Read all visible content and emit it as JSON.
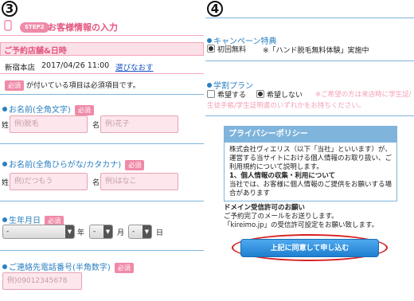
{
  "left": {
    "step_number": "3",
    "step_badge": "STEP2",
    "title": "お客様情報の入力",
    "store_section_title": "ご予約店舗&日時",
    "store_name": "新宿本店",
    "store_datetime": "2017/04/26 11:00",
    "reselect_link": "選びなおす",
    "required_note_badge": "必須",
    "required_note_text": "が付いている項目は必須項目です。",
    "name_kanji": {
      "label": "お名前(全角文字)",
      "badge": "必須",
      "sei_label": "姓",
      "mei_label": "名",
      "sei_placeholder": "例)脱毛",
      "mei_placeholder": "例)花子"
    },
    "name_kana": {
      "label": "お名前(全角ひらがな/カタカナ)",
      "badge": "必須",
      "sei_label": "姓",
      "mei_label": "名",
      "sei_placeholder": "例)だつもう",
      "mei_placeholder": "例)はなこ"
    },
    "birthday": {
      "label": "生年月日",
      "badge": "必須",
      "year_value": "-",
      "month_value": "-",
      "day_value": "-",
      "year_label": "年",
      "month_label": "月",
      "day_label": "日",
      "arrow": "▼"
    },
    "phone": {
      "label": "ご連絡先電話番号(半角数字)",
      "badge": "必須",
      "placeholder": "例)09012345678"
    }
  },
  "right": {
    "step_number": "4",
    "campaign_label": "キャンペーン特典",
    "campaign_option": "初回無料",
    "campaign_note": "※「ハンド脱毛無料体験」実施中",
    "student_label": "学割プラン",
    "student_yes": "希望する",
    "student_no": "希望しない",
    "student_note": "※ご希望の方は来店時に学生証/生徒手帳/学生証明書のいずれかをお持ちください。",
    "privacy_title": "プライバシーポリシー",
    "privacy_body_1": "株式会社ヴィエリス（以下「当社」といいます）が、運営する当サイトにおける個人情報のお取り扱い、ご利用規約について説明します。",
    "privacy_heading": "1、個人情報の収集・利用について",
    "privacy_body_2": "当社では、お客様に個人情報のご提供をお願いする場合があります",
    "domain_title": "ドメイン受信許可のお願い",
    "domain_line1": "ご予約完了のメールをお送りします。",
    "domain_line2": "「kireimo.jp」の受信許可設定をお願い致します。",
    "submit_label": "上記に同意して申し込む"
  },
  "colors": {
    "pink": "#f08aa8",
    "blue": "#2a7fc1",
    "red_ring": "#d82020"
  }
}
